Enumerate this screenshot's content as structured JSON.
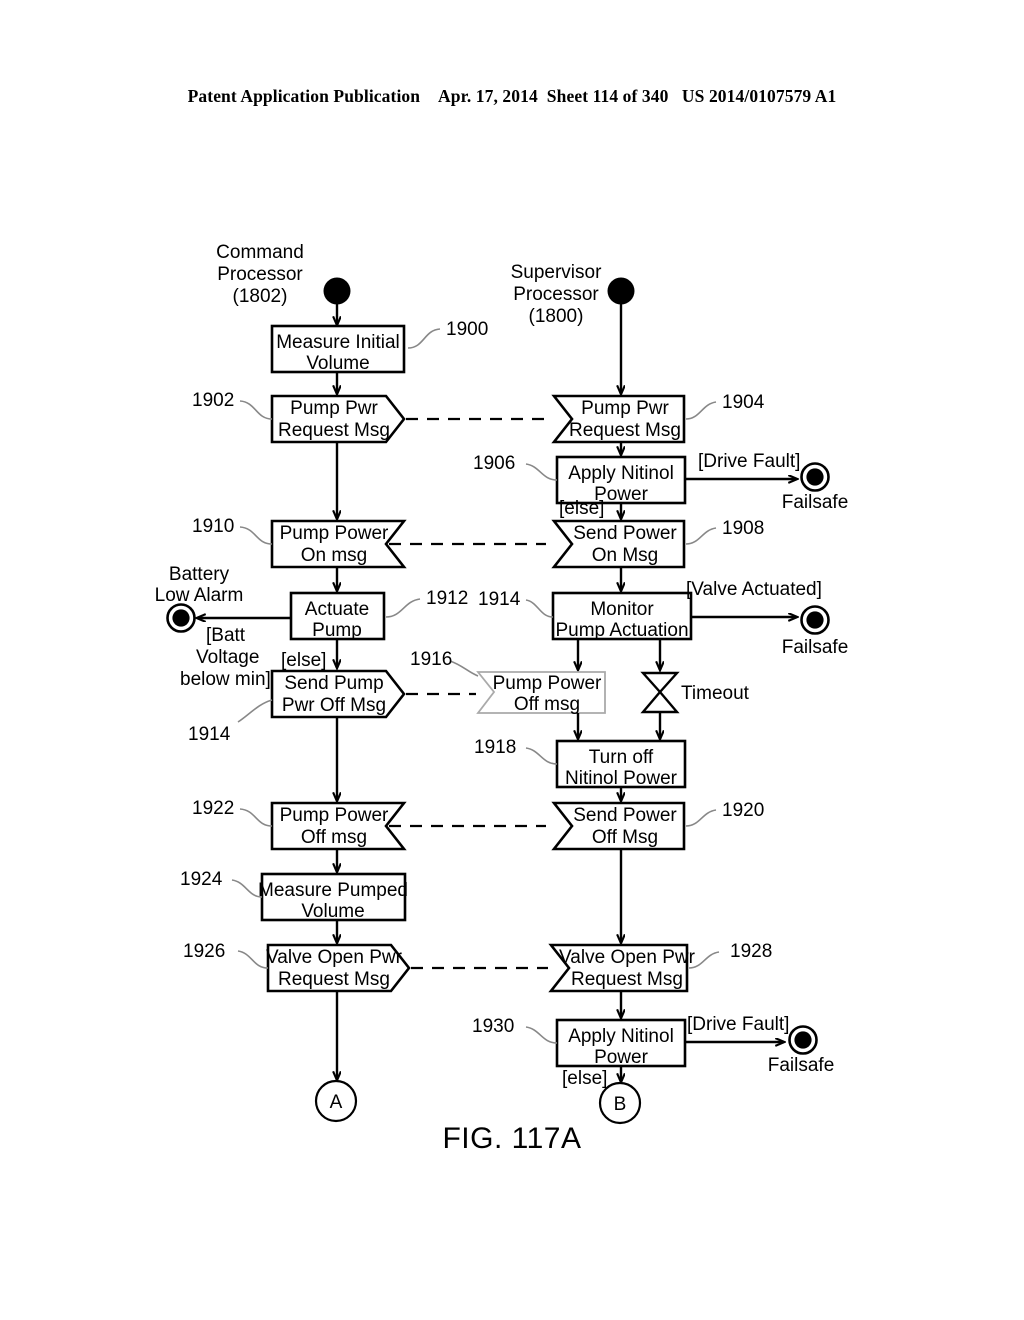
{
  "header": {
    "publication": "Patent Application Publication",
    "date": "Apr. 17, 2014",
    "sheet": "Sheet 114 of 340",
    "number": "US 2014/0107579 A1"
  },
  "figure": {
    "caption": "FIG. 117A",
    "swimlanes": [
      {
        "id": "command",
        "title_line1": "Command",
        "title_line2": "Processor",
        "title_line3": "(1802)"
      },
      {
        "id": "supervisor",
        "title_line1": "Supervisor",
        "title_line2": "Processor",
        "title_line3": "(1800)"
      }
    ],
    "nodes": {
      "n1900": {
        "ref": "1900",
        "line1": "Measure Initial",
        "line2": "Volume"
      },
      "n1902": {
        "ref": "1902",
        "line1": "Pump Pwr",
        "line2": "Request Msg"
      },
      "n1904": {
        "ref": "1904",
        "line1": "Pump Pwr",
        "line2": "Request Msg"
      },
      "n1906": {
        "ref": "1906",
        "line1": "Apply Nitinol",
        "line2": "Power"
      },
      "n1908": {
        "ref": "1908",
        "line1": "Send Power",
        "line2": "On Msg"
      },
      "n1910": {
        "ref": "1910",
        "line1": "Pump Power",
        "line2": "On msg"
      },
      "n1912": {
        "ref": "1912",
        "line1": "Actuate",
        "line2": "Pump"
      },
      "n1914r": {
        "ref": "1914",
        "line1": "Monitor",
        "line2": "Pump Actuation"
      },
      "n1914l": {
        "ref": "1914",
        "line1": "Send Pump",
        "line2": "Pwr Off Msg"
      },
      "n1916": {
        "ref": "1916",
        "line1": "Pump Power",
        "line2": "Off msg"
      },
      "n1918": {
        "ref": "1918",
        "line1": "Turn off",
        "line2": "Nitinol Power"
      },
      "n1920": {
        "ref": "1920",
        "line1": "Send Power",
        "line2": "Off Msg"
      },
      "n1922": {
        "ref": "1922",
        "line1": "Pump Power",
        "line2": "Off msg"
      },
      "n1924": {
        "ref": "1924",
        "line1": "Measure Pumped",
        "line2": "Volume"
      },
      "n1926": {
        "ref": "1926",
        "line1": "Valve Open Pwr",
        "line2": "Request Msg"
      },
      "n1928": {
        "ref": "1928",
        "line1": "Valve Open Pwr",
        "line2": "Request Msg"
      },
      "n1930": {
        "ref": "1930",
        "line1": "Apply Nitinol",
        "line2": "Power"
      }
    },
    "guards": {
      "drive_fault_top": "[Drive Fault]",
      "drive_fault_bottom": "[Drive Fault]",
      "else_1906": "[else]",
      "else_1912": "[else]",
      "else_1930": "[else]",
      "valve_actuated": "[Valve Actuated]",
      "batt_line1": "[Batt",
      "batt_line2": "Voltage",
      "batt_line3": "below min]",
      "timeout": "Timeout"
    },
    "end_states": {
      "failsafe_1": "Failsafe",
      "failsafe_2": "Failsafe",
      "failsafe_3": "Failsafe",
      "battery_alarm_line1": "Battery",
      "battery_alarm_line2": "Low Alarm"
    },
    "connectors": {
      "a": "A",
      "b": "B"
    }
  }
}
